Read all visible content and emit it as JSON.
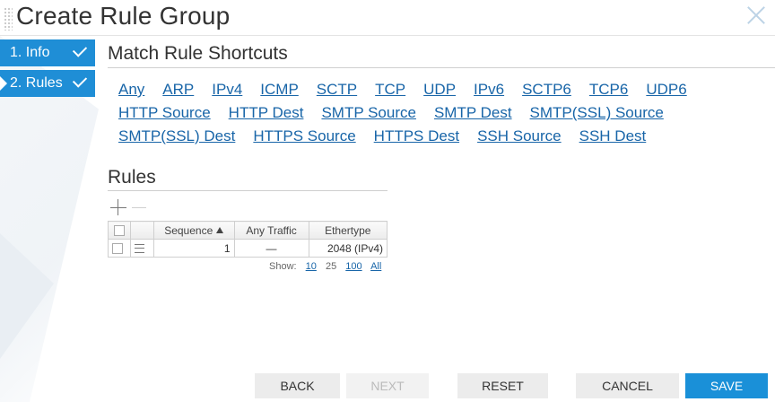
{
  "window": {
    "title": "Create Rule Group"
  },
  "steps": [
    {
      "label": "1. Info"
    },
    {
      "label": "2. Rules"
    }
  ],
  "shortcuts": {
    "title": "Match Rule Shortcuts",
    "rows": [
      [
        "Any",
        "ARP",
        "IPv4",
        "ICMP",
        "SCTP",
        "TCP",
        "UDP",
        "IPv6",
        "SCTP6",
        "TCP6",
        "UDP6"
      ],
      [
        "HTTP Source",
        "HTTP Dest",
        "SMTP Source",
        "SMTP Dest",
        "SMTP(SSL) Source"
      ],
      [
        "SMTP(SSL) Dest",
        "HTTPS Source",
        "HTTPS Dest",
        "SSH Source",
        "SSH Dest"
      ]
    ]
  },
  "rules": {
    "title": "Rules",
    "columns": [
      "Sequence",
      "Any Traffic",
      "Ethertype"
    ],
    "rows": [
      {
        "sequence": "1",
        "any_traffic": "—",
        "ethertype": "2048 (IPv4)"
      }
    ],
    "pager": {
      "label": "Show:",
      "options": [
        "10",
        "25",
        "100",
        "All"
      ]
    }
  },
  "buttons": {
    "back": "BACK",
    "next": "NEXT",
    "reset": "RESET",
    "cancel": "CANCEL",
    "save": "SAVE"
  },
  "colors": {
    "accent": "#1f8ed6",
    "link": "#1865a8",
    "save": "#1a90d8"
  }
}
